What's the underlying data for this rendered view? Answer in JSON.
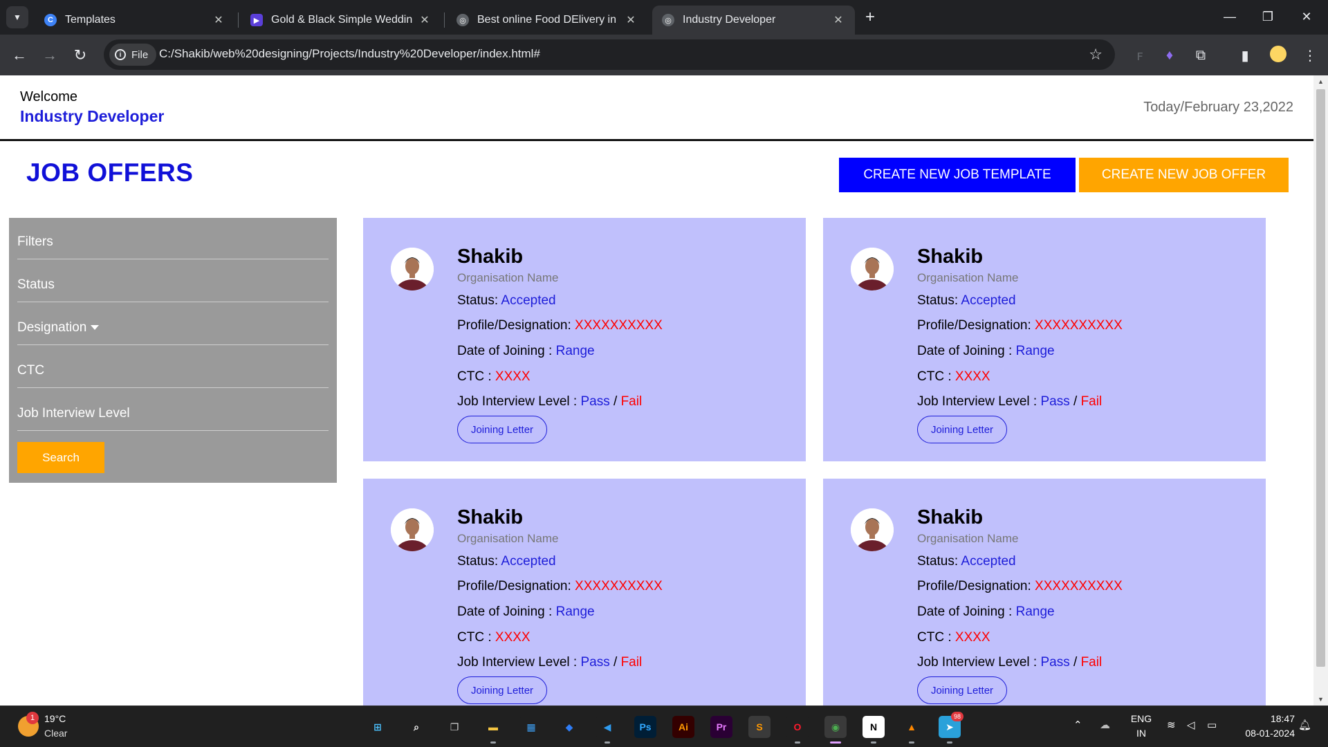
{
  "browser": {
    "tabs": [
      {
        "title": "Templates",
        "active": false,
        "favicon_color": "#3d82f6",
        "favicon_glyph": "C"
      },
      {
        "title": "Gold & Black Simple Wedding I",
        "active": false,
        "favicon_color": "#5b3fd9",
        "favicon_glyph": "▶"
      },
      {
        "title": "Best online Food DElivery in Ind",
        "active": false,
        "favicon_color": "#5f6368",
        "favicon_glyph": "◎"
      },
      {
        "title": "Industry Developer",
        "active": true,
        "favicon_color": "#5f6368",
        "favicon_glyph": "◎"
      }
    ],
    "scheme_chip": "File",
    "url": "C:/Shakib/web%20designing/Projects/Industry%20Developer/index.html#"
  },
  "header": {
    "welcome": "Welcome",
    "brand": "Industry Developer",
    "date": "Today/February 23,2022"
  },
  "page": {
    "title": "JOB OFFERS",
    "btn_template": "CREATE NEW JOB TEMPLATE",
    "btn_offer": "CREATE NEW JOB OFFER"
  },
  "filters": {
    "items": [
      "Filters",
      "Status",
      "Designation",
      "CTC",
      "Job Interview Level"
    ],
    "search": "Search"
  },
  "cards": [
    {
      "name": "Shakib",
      "org": "Organisation Name",
      "status_label": "Status:",
      "status": "Accepted",
      "profile_label": "Profile/Designation:",
      "profile": "XXXXXXXXXX",
      "doj_label": "Date of Joining :",
      "doj": "Range",
      "ctc_label": "CTC :",
      "ctc": "XXXX",
      "jil_label": "Job Interview Level :",
      "pass": "Pass",
      "sep": "/",
      "fail": "Fail",
      "letter": "Joining Letter"
    },
    {
      "name": "Shakib",
      "org": "Organisation Name",
      "status_label": "Status:",
      "status": "Accepted",
      "profile_label": "Profile/Designation:",
      "profile": "XXXXXXXXXX",
      "doj_label": "Date of Joining :",
      "doj": "Range",
      "ctc_label": "CTC :",
      "ctc": "XXXX",
      "jil_label": "Job Interview Level :",
      "pass": "Pass",
      "sep": "/",
      "fail": "Fail",
      "letter": "Joining Letter"
    },
    {
      "name": "Shakib",
      "org": "Organisation Name",
      "status_label": "Status:",
      "status": "Accepted",
      "profile_label": "Profile/Designation:",
      "profile": "XXXXXXXXXX",
      "doj_label": "Date of Joining :",
      "doj": "Range",
      "ctc_label": "CTC :",
      "ctc": "XXXX",
      "jil_label": "Job Interview Level :",
      "pass": "Pass",
      "sep": "/",
      "fail": "Fail",
      "letter": "Joining Letter"
    },
    {
      "name": "Shakib",
      "org": "Organisation Name",
      "status_label": "Status:",
      "status": "Accepted",
      "profile_label": "Profile/Designation:",
      "profile": "XXXXXXXXXX",
      "doj_label": "Date of Joining :",
      "doj": "Range",
      "ctc_label": "CTC :",
      "ctc": "XXXX",
      "jil_label": "Job Interview Level :",
      "pass": "Pass",
      "sep": "/",
      "fail": "Fail",
      "letter": "Joining Letter"
    }
  ],
  "taskbar": {
    "weather_badge": "1",
    "weather_temp": "19°C",
    "weather_desc": "Clear",
    "apps": [
      {
        "name": "windows-start-icon",
        "glyph": "⊞",
        "bg": "#202020",
        "fg": "#4cc2ff"
      },
      {
        "name": "search-icon",
        "glyph": "⌕",
        "bg": "#202020",
        "fg": "#ffffff"
      },
      {
        "name": "task-view-icon",
        "glyph": "❐",
        "bg": "#202020",
        "fg": "#d0d0d0"
      },
      {
        "name": "file-explorer-icon",
        "glyph": "▬",
        "bg": "#202020",
        "fg": "#f4c542"
      },
      {
        "name": "store-icon",
        "glyph": "▦",
        "bg": "#202020",
        "fg": "#3d9df0"
      },
      {
        "name": "dropbox-icon",
        "glyph": "◆",
        "bg": "#202020",
        "fg": "#2f7df6"
      },
      {
        "name": "vscode-icon",
        "glyph": "◀",
        "bg": "#202020",
        "fg": "#2f9cf0"
      },
      {
        "name": "photoshop-icon",
        "glyph": "Ps",
        "bg": "#001e36",
        "fg": "#31a8ff"
      },
      {
        "name": "illustrator-icon",
        "glyph": "Ai",
        "bg": "#330000",
        "fg": "#ff9a00"
      },
      {
        "name": "premiere-icon",
        "glyph": "Pr",
        "bg": "#2a0034",
        "fg": "#e77bff"
      },
      {
        "name": "sublime-icon",
        "glyph": "S",
        "bg": "#3a3a3a",
        "fg": "#ff9800"
      },
      {
        "name": "opera-icon",
        "glyph": "O",
        "bg": "#202020",
        "fg": "#ff1b2d"
      },
      {
        "name": "chrome-icon",
        "glyph": "◉",
        "bg": "#3a3a3a",
        "fg": "#4caf50"
      },
      {
        "name": "notion-icon",
        "glyph": "N",
        "bg": "#ffffff",
        "fg": "#000000"
      },
      {
        "name": "vlc-icon",
        "glyph": "▲",
        "bg": "#202020",
        "fg": "#ff8800"
      },
      {
        "name": "telegram-icon",
        "glyph": "➤",
        "bg": "#2aa1da",
        "fg": "#ffffff"
      }
    ],
    "telegram_badge": "98",
    "lang_top": "ENG",
    "lang_bottom": "IN",
    "time": "18:47",
    "date": "08-01-2024"
  }
}
